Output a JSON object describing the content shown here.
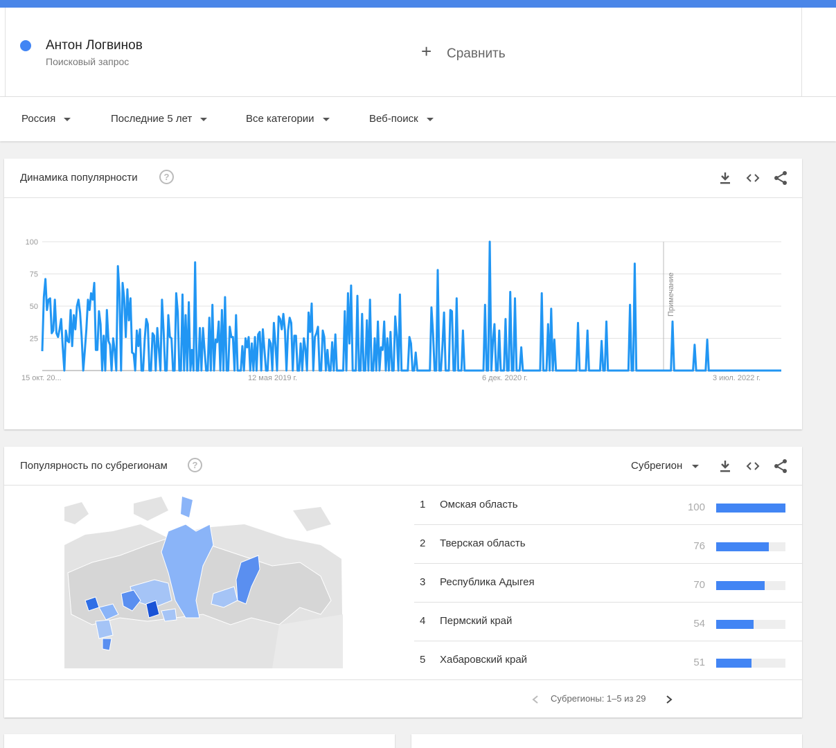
{
  "term": {
    "name": "Антон Логвинов",
    "type": "Поисковый запрос",
    "color": "#4285f4"
  },
  "compare": {
    "icon": "plus-icon",
    "label": "Сравнить"
  },
  "filters": [
    {
      "label": "Россия"
    },
    {
      "label": "Последние 5 лет"
    },
    {
      "label": "Все категории"
    },
    {
      "label": "Веб-поиск"
    }
  ],
  "interest_over_time": {
    "title": "Динамика популярности",
    "note_label": "Примечание",
    "icons": [
      "download-icon",
      "embed-code-icon",
      "share-icon"
    ]
  },
  "chart_data": {
    "type": "line",
    "title": "",
    "xlabel": "",
    "ylabel": "",
    "ylim": [
      0,
      100
    ],
    "yticks": [
      25,
      50,
      75,
      100
    ],
    "x_tick_labels": [
      "15 окт. 20...",
      "12 мая 2019 г.",
      "6 дек. 2020 г.",
      "3 июл. 2022 г."
    ],
    "grid": true,
    "series": [
      {
        "color": "#2196f3",
        "values": [
          15,
          57,
          71,
          47,
          55,
          56,
          29,
          31,
          55,
          29,
          26,
          32,
          40,
          18,
          0,
          31,
          23,
          22,
          47,
          19,
          43,
          32,
          50,
          55,
          45,
          26,
          0,
          15,
          32,
          55,
          47,
          60,
          55,
          68,
          16,
          16,
          46,
          36,
          0,
          27,
          0,
          47,
          23,
          20,
          0,
          25,
          15,
          0,
          81,
          60,
          0,
          68,
          56,
          26,
          63,
          39,
          56,
          14,
          13,
          0,
          31,
          19,
          32,
          0,
          0,
          24,
          40,
          36,
          0,
          0,
          29,
          27,
          0,
          33,
          16,
          0,
          55,
          31,
          0,
          0,
          43,
          26,
          25,
          0,
          0,
          60,
          45,
          0,
          0,
          59,
          0,
          43,
          0,
          53,
          0,
          16,
          0,
          84,
          0,
          0,
          33,
          0,
          33,
          16,
          0,
          0,
          41,
          0,
          51,
          0,
          24,
          22,
          38,
          0,
          47,
          0,
          57,
          0,
          0,
          34,
          26,
          26,
          0,
          43,
          0,
          0,
          0,
          19,
          0,
          25,
          18,
          26,
          0,
          21,
          0,
          26,
          0,
          28,
          30,
          0,
          32,
          16,
          0,
          0,
          24,
          21,
          0,
          37,
          20,
          0,
          42,
          40,
          32,
          44,
          31,
          0,
          31,
          41,
          37,
          0,
          27,
          27,
          0,
          0,
          21,
          0,
          25,
          17,
          0,
          45,
          30,
          52,
          0,
          26,
          29,
          34,
          0,
          0,
          31,
          26,
          0,
          16,
          0,
          0,
          22,
          0,
          28,
          0,
          0,
          0,
          0,
          0,
          46,
          0,
          60,
          21,
          66,
          0,
          0,
          0,
          58,
          0,
          0,
          44,
          0,
          0,
          39,
          0,
          55,
          0,
          0,
          25,
          0,
          38,
          0,
          18,
          16,
          38,
          0,
          25,
          0,
          30,
          0,
          0,
          42,
          27,
          0,
          59,
          0,
          0,
          0,
          0,
          0,
          26,
          21,
          0,
          0,
          14,
          0,
          0,
          0,
          0,
          0,
          0,
          0,
          0,
          0,
          49,
          29,
          0,
          0,
          78,
          0,
          0,
          20,
          45,
          0,
          0,
          0,
          47,
          46,
          0,
          0,
          56,
          0,
          0,
          0,
          31,
          0,
          0,
          0,
          0,
          0,
          0,
          0,
          0,
          0,
          0,
          0,
          0,
          0,
          51,
          0,
          0,
          100,
          0,
          23,
          36,
          0,
          0,
          31,
          0,
          0,
          0,
          40,
          0,
          0,
          61,
          0,
          0,
          56,
          0,
          0,
          0,
          18,
          0,
          0,
          0,
          0,
          0,
          0,
          0,
          0,
          0,
          0,
          0,
          0,
          60,
          0,
          0,
          0,
          36,
          0,
          48,
          0,
          24,
          0,
          0,
          0,
          0,
          0,
          0,
          0,
          0,
          0,
          0,
          0,
          0,
          0,
          0,
          37,
          0,
          0,
          0,
          0,
          0,
          31,
          0,
          0,
          0,
          0,
          0,
          0,
          0,
          0,
          23,
          0,
          0,
          38,
          0,
          0,
          0,
          0,
          0,
          0,
          0,
          0,
          0,
          0,
          0,
          0,
          0,
          0,
          51,
          0,
          0,
          83,
          0,
          0,
          0,
          0,
          0,
          0,
          0,
          0,
          0,
          0,
          0,
          0,
          0,
          0,
          0,
          0,
          0,
          0,
          0,
          0,
          0,
          0,
          0,
          38,
          0,
          0,
          0,
          0,
          0,
          0,
          0,
          0,
          0,
          0,
          0,
          0,
          0,
          20,
          0,
          0,
          0,
          0,
          0,
          0,
          0,
          24,
          0,
          0,
          0,
          0,
          0,
          0,
          0,
          0,
          0,
          0,
          0,
          0,
          0,
          0,
          0,
          0,
          0,
          0,
          0,
          0,
          0,
          0,
          0,
          0,
          0,
          0,
          0,
          0,
          0,
          0,
          0,
          0,
          0,
          0,
          0,
          0,
          0,
          0,
          0,
          0,
          0,
          0,
          0,
          0,
          0,
          0,
          0
        ]
      }
    ]
  },
  "subregions": {
    "title": "Популярность по субрегионам",
    "dropdown_label": "Субрегион",
    "icons": [
      "download-icon",
      "embed-code-icon",
      "share-icon"
    ],
    "rows": [
      {
        "rank": "1",
        "name": "Омская область",
        "value": 100
      },
      {
        "rank": "2",
        "name": "Тверская область",
        "value": 76
      },
      {
        "rank": "3",
        "name": "Республика Адыгея",
        "value": 70
      },
      {
        "rank": "4",
        "name": "Пермский край",
        "value": 54
      },
      {
        "rank": "5",
        "name": "Хабаровский край",
        "value": 51
      }
    ],
    "pager_label": "Субрегионы: 1–5 из 29",
    "bar_color": "#4285f4"
  }
}
